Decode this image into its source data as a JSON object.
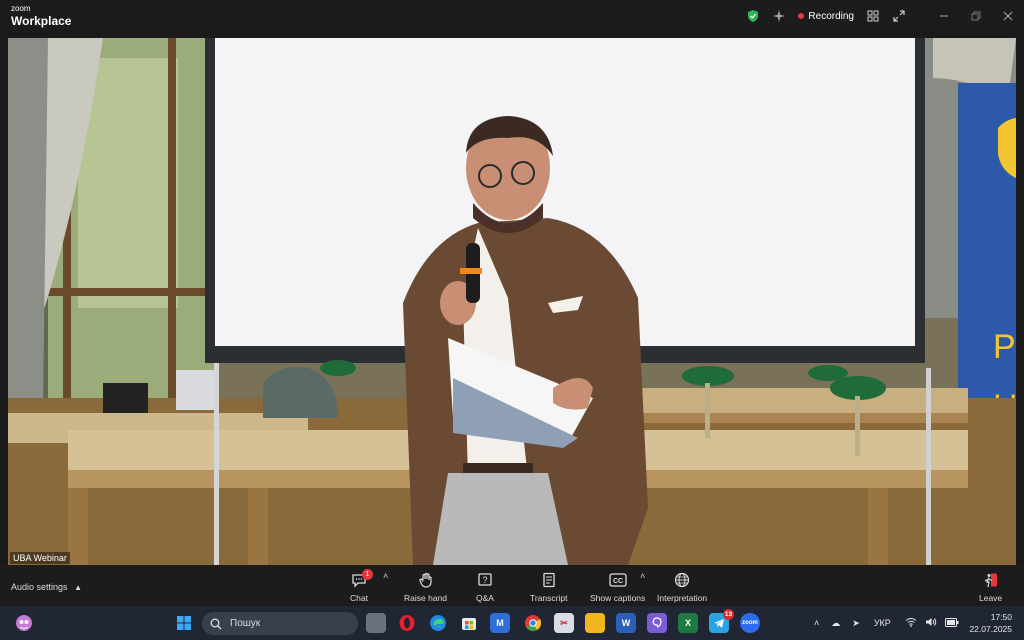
{
  "app": {
    "brand_small": "zoom",
    "brand_big": "Workplace"
  },
  "titlebar": {
    "recording_label": "Recording"
  },
  "meeting": {
    "speaker_name": "UBA Webinar"
  },
  "controls": {
    "audio_settings": "Audio settings",
    "chat": {
      "label": "Chat",
      "badge": "1"
    },
    "raise_hand": "Raise hand",
    "qa": "Q&A",
    "transcript": "Transcript",
    "captions": "Show captions",
    "interpretation": "Interpretation",
    "leave": "Leave"
  },
  "taskbar": {
    "search_placeholder": "Пошук",
    "telegram_badge": "13",
    "language": "УКР",
    "time": "17:50",
    "date": "22.07.2025"
  },
  "colors": {
    "recording_dot": "#e5383b",
    "leave_icon": "#e5383b",
    "taskbar_bg": "#202633"
  }
}
